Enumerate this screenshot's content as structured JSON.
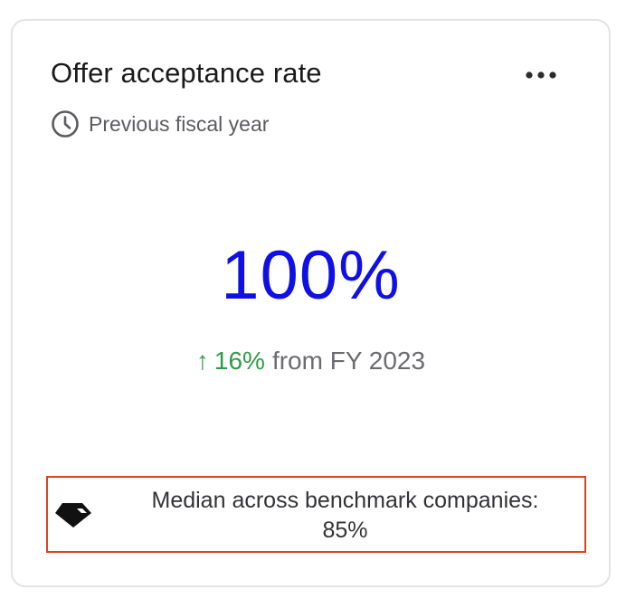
{
  "card": {
    "title": "Offer acceptance rate",
    "more_menu_icon": "more-horizontal-icon",
    "period": {
      "icon": "clock-icon",
      "label": "Previous fiscal year"
    },
    "metric": {
      "value": "100%",
      "color": "#1010e6"
    },
    "change": {
      "arrow": "↑",
      "value": "16%",
      "suffix": "from FY 2023",
      "color": "#2f9a45"
    },
    "benchmark": {
      "icon": "gem-icon",
      "text_line1": "Median across benchmark companies:",
      "text_line2": "85%",
      "highlight_color": "#e0431f"
    }
  }
}
